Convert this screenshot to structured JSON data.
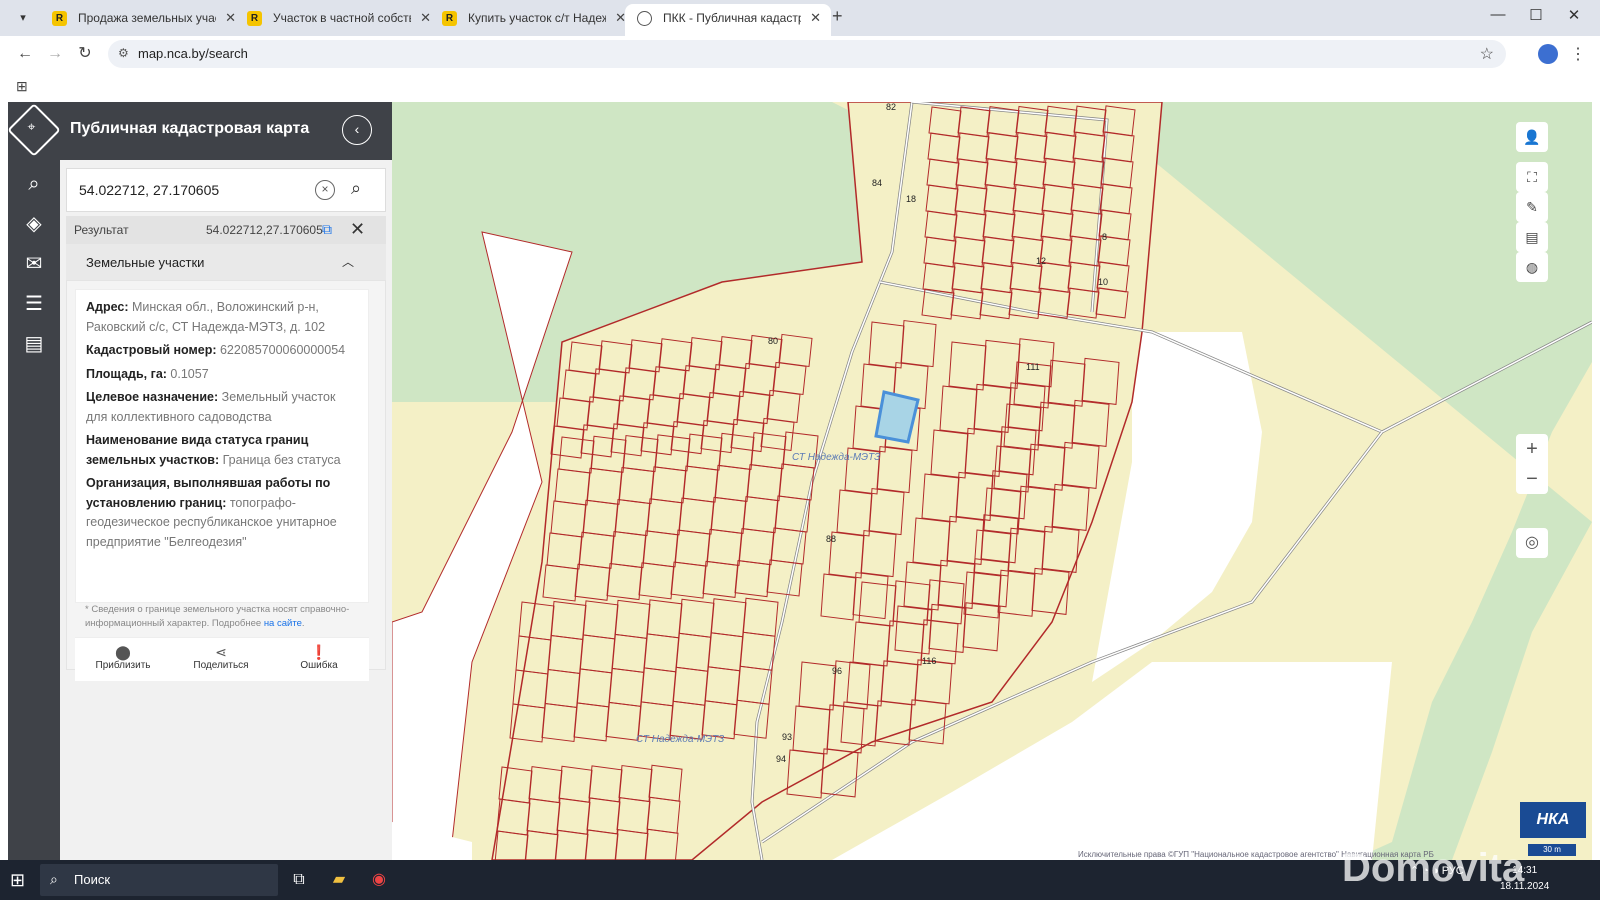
{
  "browser": {
    "tabs": [
      {
        "title": "Продажа земельных участков",
        "icon": "realt-icon"
      },
      {
        "title": "Участок в частной собственно",
        "icon": "realt-icon"
      },
      {
        "title": "Купить участок с/т Надежда-М",
        "icon": "realt-icon"
      },
      {
        "title": "ПКК - Публичная кадастрова",
        "icon": "globe-icon",
        "active": true
      }
    ],
    "url": "map.nca.by/search"
  },
  "app": {
    "title": "Публичная кадастровая карта",
    "search": {
      "value": "54.022712, 27.170605"
    },
    "result": {
      "label": "Результат",
      "coords": "54.022712,27.170605"
    },
    "section": {
      "title": "Земельные участки"
    },
    "parcel": {
      "address_label": "Адрес:",
      "address": "Минская обл., Воложинский р-н, Раковский с/с, СТ Надежда-МЭТЗ, д. 102",
      "cadastre_label": "Кадастровый номер:",
      "cadastre": "622085700060000054",
      "area_label": "Площадь, га:",
      "area": "0.1057",
      "purpose_label": "Целевое назначение:",
      "purpose": "Земельный участок для коллективного садоводства",
      "boundary_label": "Наименование вида статуса границ земельных участков:",
      "boundary": "Граница без статуса",
      "org_label": "Организация, выполнявшая работы по установлению границ:",
      "org": "топографо-геодезическое республиканское унитарное предприятие \"Белгеодезия\""
    },
    "note": "* Сведения о границе земельного участка носят справочно-информационный характер. Подробнее",
    "note_link": "на сайте",
    "actions": {
      "zoom": "Приблизить",
      "share": "Поделиться",
      "error": "Ошибка"
    }
  },
  "map": {
    "labels": [
      "СТ Надежда-МЭТЗ",
      "СТ Надежда-МЭТЗ"
    ],
    "lot_numbers": [
      "82",
      "84",
      "18",
      "8",
      "12",
      "10",
      "80",
      "111",
      "88",
      "96",
      "116",
      "93",
      "94"
    ],
    "attribution": "Исключительные права   ©ГУП \"Национальное кадастровое агентство\"   Навигационная карта РБ",
    "scale": "30 m",
    "logo": "НКА",
    "colors": {
      "parcel_fill": "#f4f0c6",
      "parcel_border": "#b22a2a",
      "forest": "#cfe6c4",
      "selected": "#4a90d9"
    }
  },
  "taskbar": {
    "search": "Поиск",
    "lang": "РУС",
    "time": "14:31",
    "date": "18.11.2024"
  },
  "watermark": "Domovita"
}
